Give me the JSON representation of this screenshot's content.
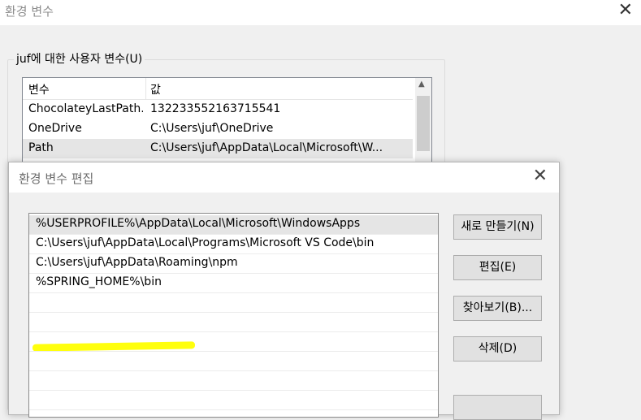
{
  "bg_window": {
    "title": "환경 변수",
    "close": "✕",
    "group_label": "juf에 대한 사용자 변수(U)",
    "columns": [
      "변수",
      "값"
    ],
    "rows": [
      {
        "name": "ChocolateyLastPath...",
        "value": "132233552163715541"
      },
      {
        "name": "OneDrive",
        "value": "C:\\Users\\juf\\OneDrive"
      },
      {
        "name": "Path",
        "value": "C:\\Users\\juf\\AppData\\Local\\Microsoft\\W..."
      }
    ]
  },
  "dialog": {
    "title": "환경 변수 편집",
    "close": "✕",
    "paths": [
      "%USERPROFILE%\\AppData\\Local\\Microsoft\\WindowsApps",
      "C:\\Users\\juf\\AppData\\Local\\Programs\\Microsoft VS Code\\bin",
      "C:\\Users\\juf\\AppData\\Roaming\\npm",
      "%SPRING_HOME%\\bin"
    ],
    "buttons": {
      "new": "새로 만들기(N)",
      "edit": "편집(E)",
      "browse": "찾아보기(B)...",
      "delete": "삭제(D)"
    }
  },
  "colors": {
    "highlight": "#ffff00",
    "selected_row": "#e5e5e5"
  }
}
